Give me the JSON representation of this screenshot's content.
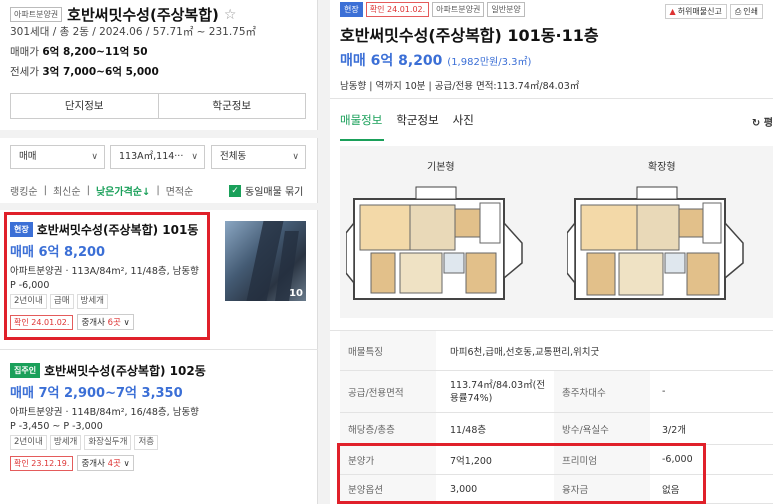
{
  "left": {
    "badge": "아파트분양권",
    "complex_name": "호반써밋수성(주상복합)",
    "info1": "301세대 / 총 2동 / 2024.06 / 57.71㎡ ~ 231.75㎡",
    "sale_label": "매매가",
    "sale_range": "6억 8,200~11억 50",
    "jeonse_label": "전세가",
    "jeonse_range": "3억 7,000~6억 5,000",
    "btn_complex_info": "단지정보",
    "btn_school_info": "학군정보",
    "filter_trade": "매매",
    "filter_area": "113A㎡,114···",
    "filter_dong": "전체동",
    "sort_rank": "랭킹순",
    "sort_latest": "최신순",
    "sort_low_price": "낮은가격순↓",
    "sort_area": "면적순",
    "same_listing_toggle": "동일매물 묶기",
    "listings": [
      {
        "badge": "현장",
        "title": "호반써밋수성(주상복합) 101동",
        "price": "매매 6억 8,200",
        "detail": "아파트분양권 · 113A/84m², 11/48층, 남동향",
        "premium": "P -6,000",
        "chips": [
          "2년이내",
          "급매",
          "방세개"
        ],
        "confirmed": "확인 24.01.02.",
        "agent_prefix": "중개사 ",
        "agent_count": "6곳",
        "photo_count": "10"
      },
      {
        "badge": "집주인",
        "title": "호반써밋수성(주상복합) 102동",
        "price": "매매 7억 2,900~7억 3,350",
        "detail": "아파트분양권 · 114B/84m², 16/48층, 남동향",
        "premium": "P -3,450 ~ P -3,000",
        "chips": [
          "2년이내",
          "방세개",
          "화장실두개",
          "저층"
        ],
        "confirmed": "확인 23.12.19.",
        "agent_prefix": "중개사 ",
        "agent_count": "4곳"
      }
    ]
  },
  "right": {
    "tags": [
      "현장",
      "확인 24.01.02.",
      "아파트분양권",
      "일반분양"
    ],
    "report_btn": "허위매물신고",
    "print_btn": "인쇄",
    "title": "호반써밋수성(주상복합) 101동·11층",
    "price": "매매 6억 8,200",
    "price_per": "(1,982만원/3.3㎡)",
    "meta": "남동향 | 역까지 10분 | 공급/전용 면적:113.74㎡/84.03㎡",
    "tabs": [
      "매물정보",
      "학군정보",
      "사진"
    ],
    "refresh": "평",
    "plan_basic": "기본형",
    "plan_extended": "확장형",
    "table": {
      "features_k": "매물특징",
      "features_v": "마피6천,급매,선호동,교통편리,위치굿",
      "area_k": "공급/전용면적",
      "area_v1": "113.74㎡/84.03㎡(전",
      "area_v2": "용률74%)",
      "households_k": "총주차대수",
      "households_v": "-",
      "floor_k": "해당층/총층",
      "floor_v": "11/48층",
      "rooms_k": "방수/욕실수",
      "rooms_v": "3/2개",
      "sale_price_k": "분양가",
      "sale_price_v": "7억1,200",
      "premium_k": "프리미엄",
      "premium_v": "-6,000",
      "option_k": "분양옵션",
      "option_v": "3,000",
      "loan_k": "융자금",
      "loan_v": "없음"
    }
  },
  "colors": {
    "accent_green": "#1aa05a",
    "price_blue": "#3b6fd6",
    "highlight_red": "#e0202a"
  }
}
